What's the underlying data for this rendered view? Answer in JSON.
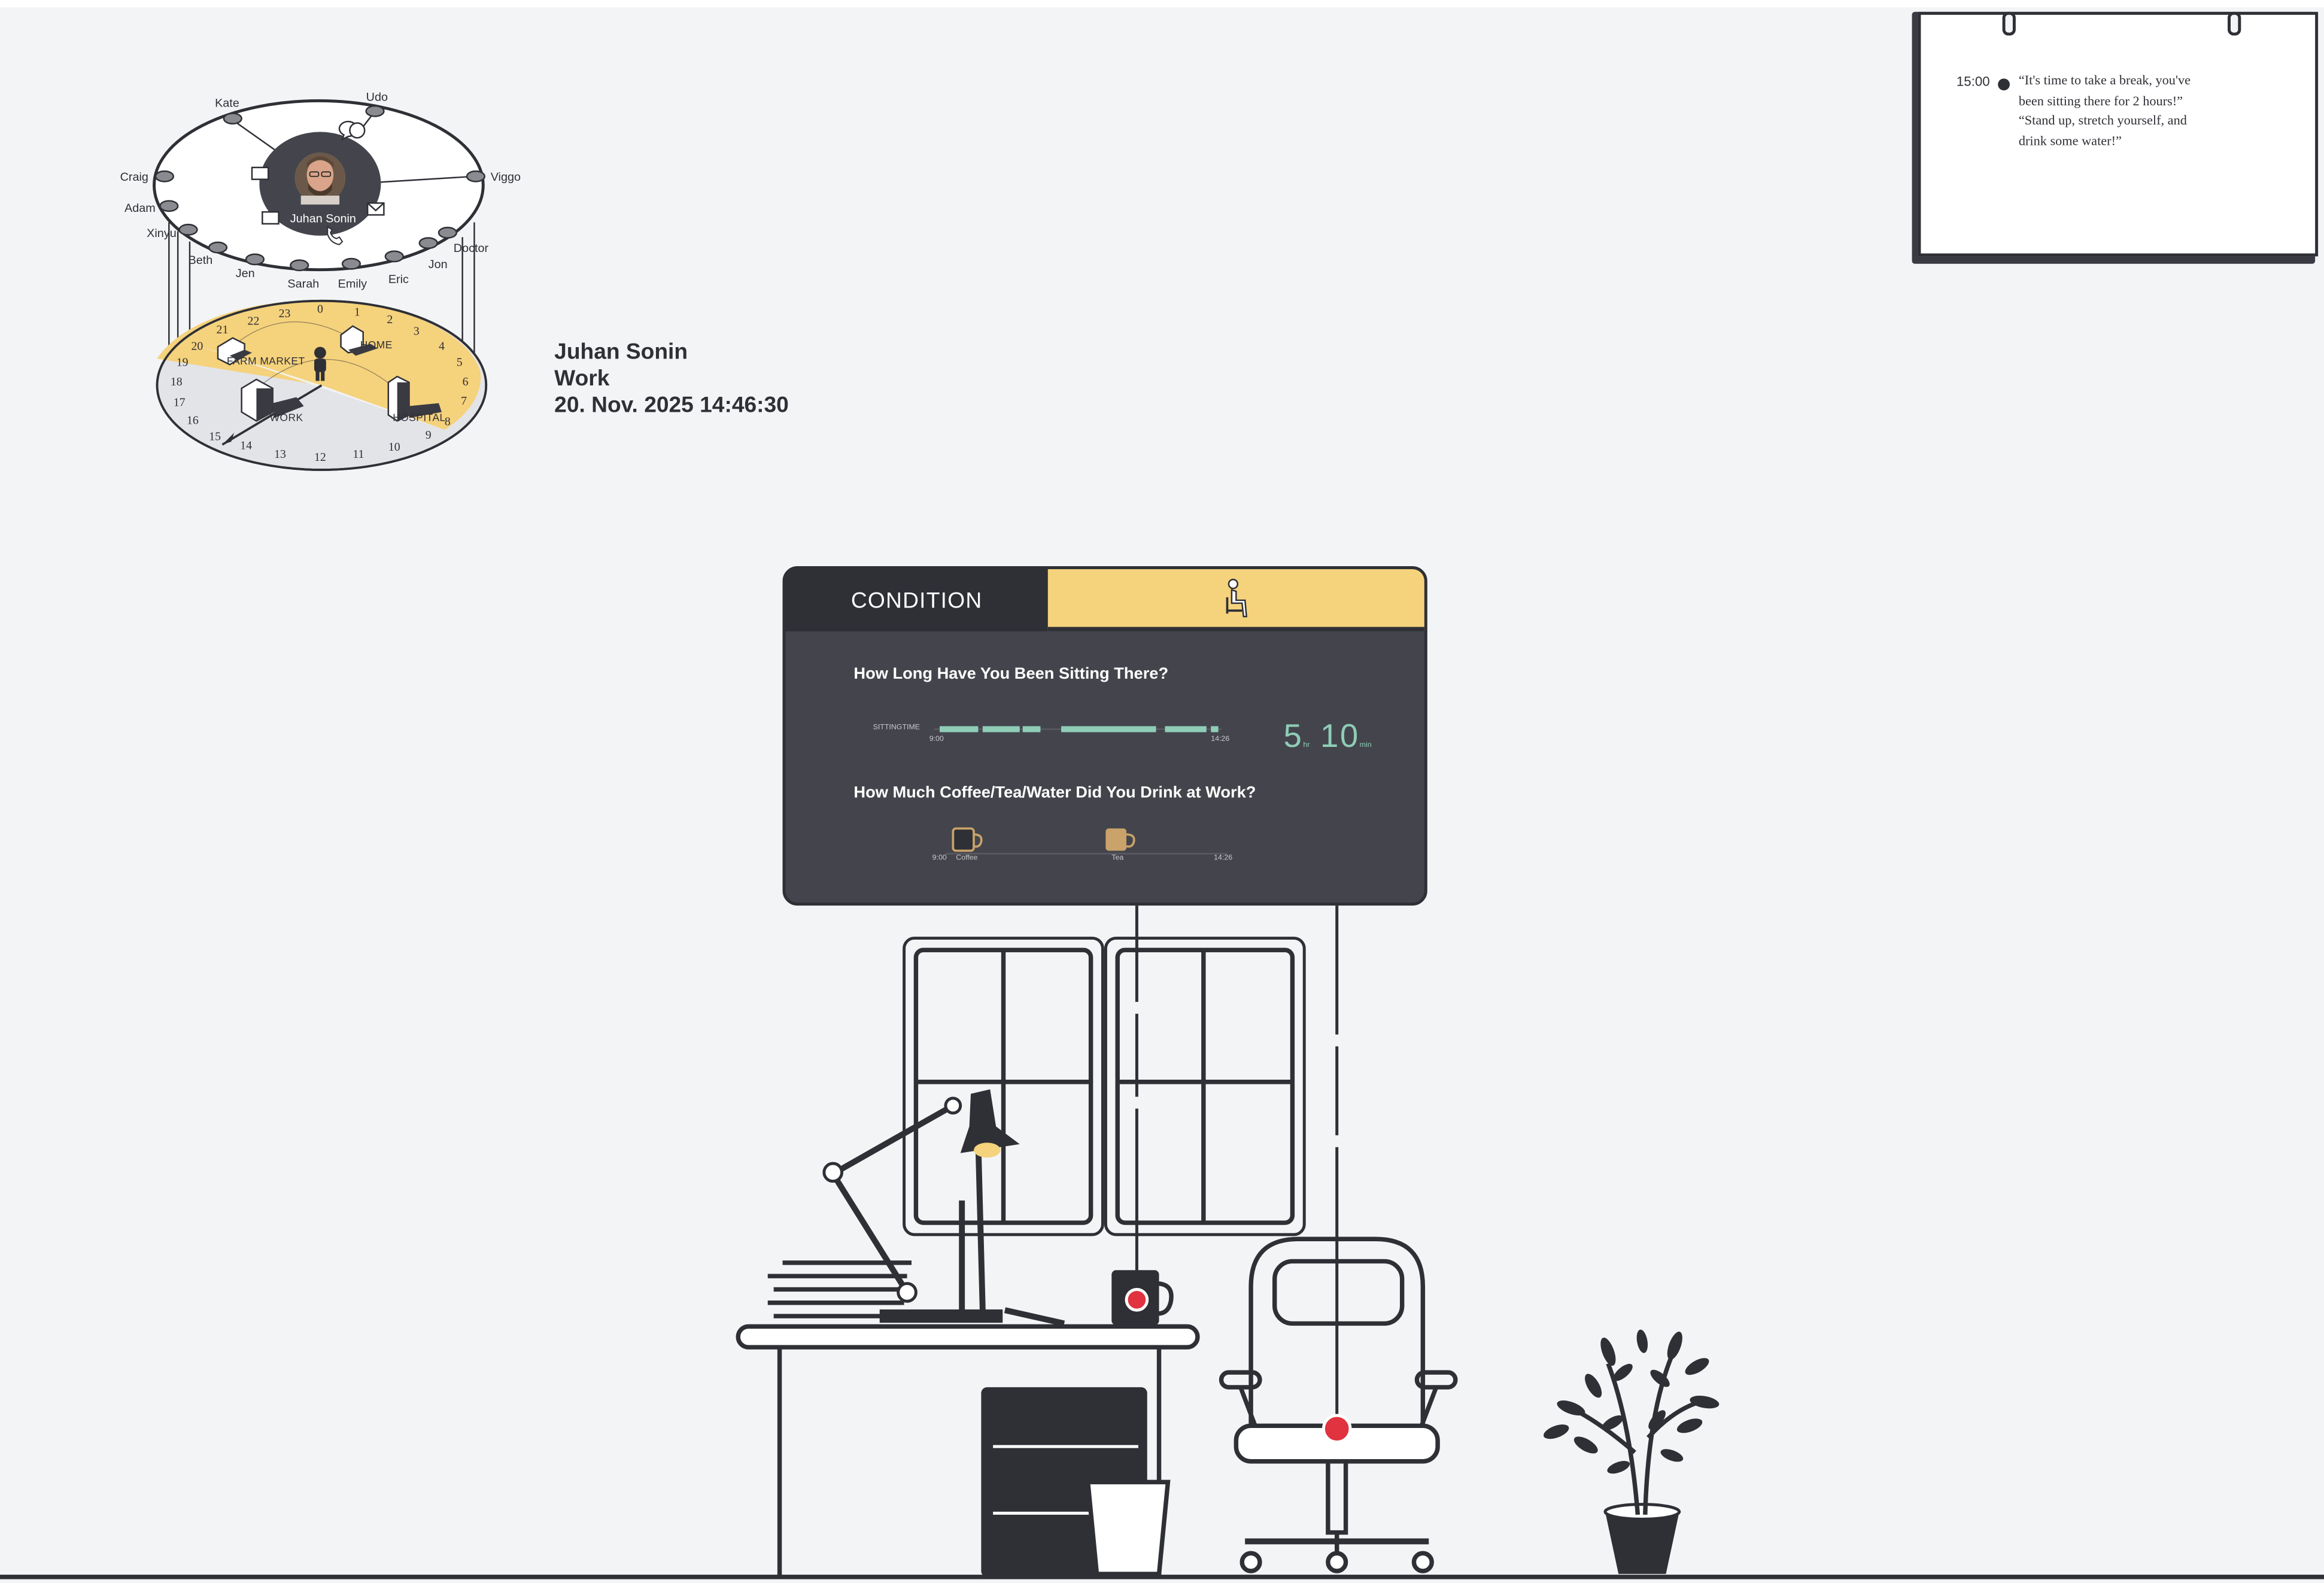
{
  "contacts": {
    "center_name": "Juhan Sonin",
    "names": [
      "Kate",
      "Udo",
      "Craig",
      "Viggo",
      "Adam",
      "Xinyu",
      "Doctor",
      "Beth",
      "Jen",
      "Sarah",
      "Emily",
      "Eric",
      "Jon"
    ]
  },
  "dial": {
    "hours": [
      "0",
      "1",
      "2",
      "3",
      "4",
      "5",
      "6",
      "7",
      "8",
      "9",
      "10",
      "11",
      "12",
      "13",
      "14",
      "15",
      "16",
      "17",
      "18",
      "19",
      "20",
      "21",
      "22",
      "23"
    ],
    "places": {
      "farm_market": "FARM MARKET",
      "home": "HOME",
      "work": "WORK",
      "hospital": "HOSPITAL"
    }
  },
  "status": {
    "name": "Juhan Sonin",
    "place": "Work",
    "datetime": "20. Nov. 2025 14:46:30"
  },
  "note": {
    "time": "15:00",
    "lines": [
      "“It's time to take a break, you've",
      "been sitting there for 2 hours!”",
      "“Stand up, stretch yourself, and",
      "drink some water!”"
    ]
  },
  "panel": {
    "tab_label": "CONDITION",
    "active_tab_icon": "sitting-person-icon",
    "q1": "How Long Have You Been Sitting There?",
    "sitting_label": "SITTINGTIME",
    "start_time": "9:00",
    "end_time": "14:26",
    "sitting_hours": "5",
    "sitting_hours_unit": "hr",
    "sitting_minutes": "10",
    "sitting_minutes_unit": "min",
    "q2": "How Much Coffee/Tea/Water Did You Drink at Work?",
    "drink_start": "9:00",
    "drink_end": "14:26",
    "drinks": [
      "Coffee",
      "Tea"
    ]
  },
  "colors": {
    "background": "#f3f4f6",
    "dark": "#2f3036",
    "panel": "#44454c",
    "accent_yellow": "#f5d27c",
    "accent_teal": "#8fcdb7",
    "accent_red": "#e0323f",
    "drink_tan": "#c9a36a"
  }
}
